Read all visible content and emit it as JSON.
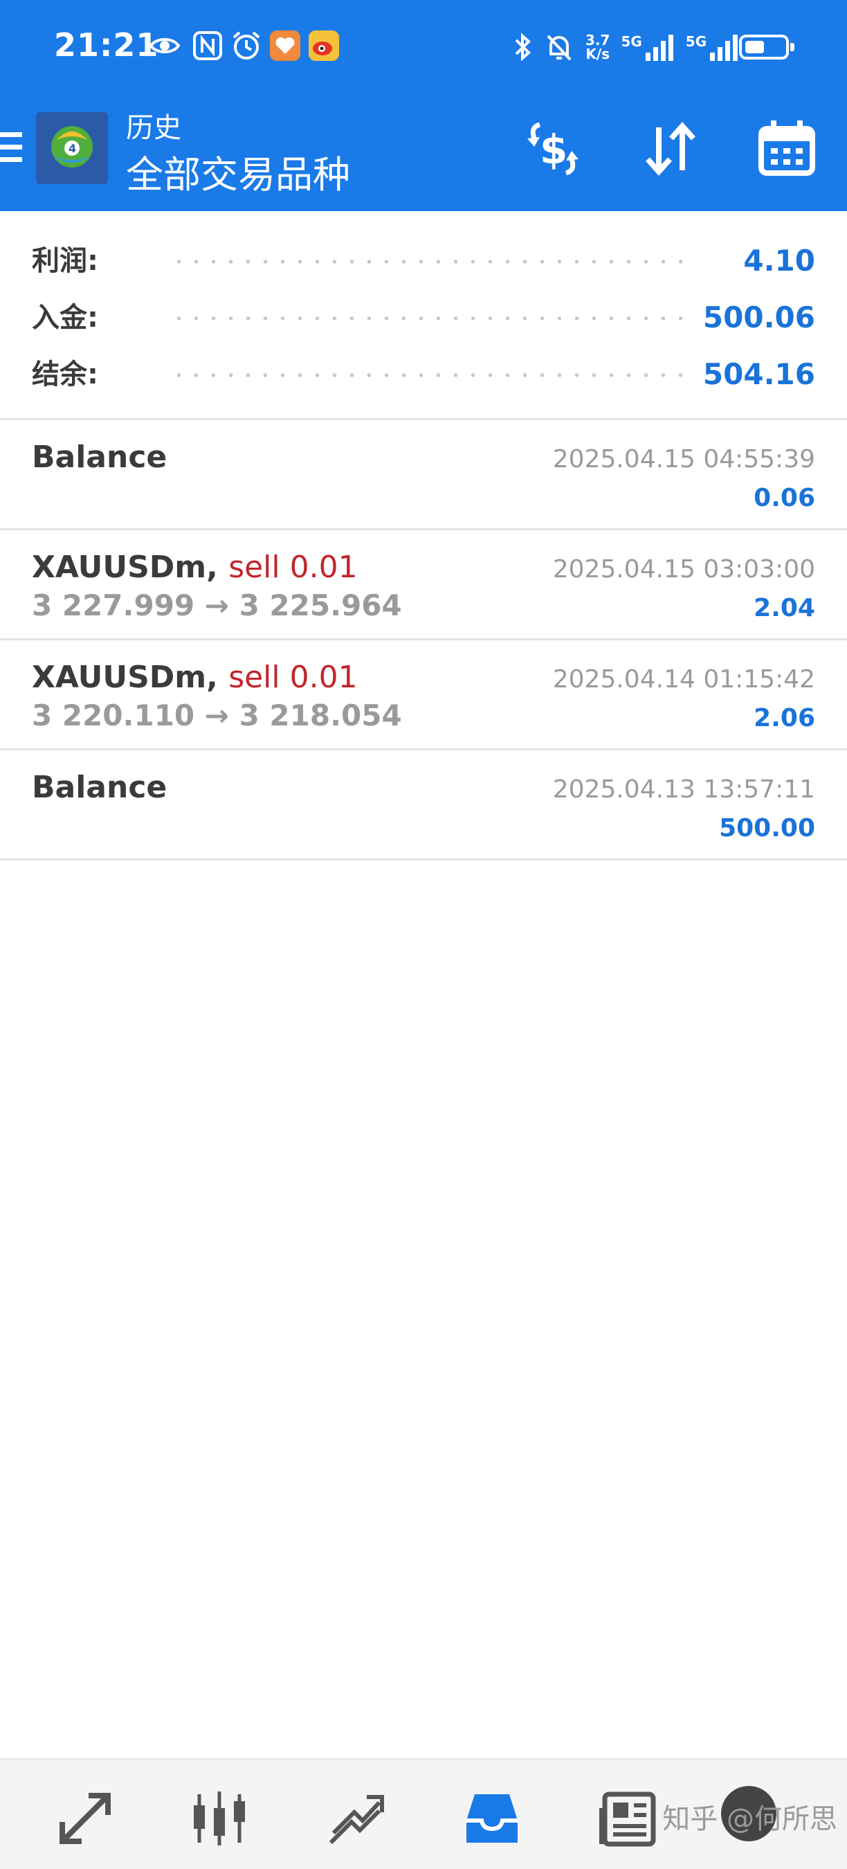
{
  "status_bar": {
    "time": "21:21",
    "net_speed_top": "3.7",
    "net_speed_bottom": "K/s",
    "signal_1": "5G",
    "signal_2": "5G",
    "battery_level": 0.5
  },
  "header": {
    "subtitle": "历史",
    "title": "全部交易品种",
    "icons": [
      "hamburger-menu-icon",
      "metatrader-logo",
      "dollar-exchange-icon",
      "sort-icon",
      "calendar-icon"
    ]
  },
  "summary": [
    {
      "label": "利润:",
      "value": "4.10"
    },
    {
      "label": "入金:",
      "value": "500.06"
    },
    {
      "label": "结余:",
      "value": "504.16"
    }
  ],
  "history": [
    {
      "title": "Balance",
      "type": "",
      "prices": "",
      "date": "2025.04.15 04:55:39",
      "amount": "0.06"
    },
    {
      "title": "XAUUSDm,",
      "type": "sell 0.01",
      "prices": "3 227.999 → 3 225.964",
      "date": "2025.04.15 03:03:00",
      "amount": "2.04"
    },
    {
      "title": "XAUUSDm,",
      "type": "sell 0.01",
      "prices": "3 220.110 → 3 218.054",
      "date": "2025.04.14 01:15:42",
      "amount": "2.06"
    },
    {
      "title": "Balance",
      "type": "",
      "prices": "",
      "date": "2025.04.13 13:57:11",
      "amount": "500.00"
    }
  ],
  "bottom_nav": {
    "items": [
      "quotes-icon",
      "chart-candles-icon",
      "trade-icon",
      "history-inbox-icon",
      "news-icon"
    ],
    "active": "history-inbox-icon"
  },
  "watermark": "知乎 @何所思",
  "colors": {
    "header_bg": "#1a7ae8",
    "value_blue": "#1a73d8",
    "sell_red": "#c0262d"
  }
}
